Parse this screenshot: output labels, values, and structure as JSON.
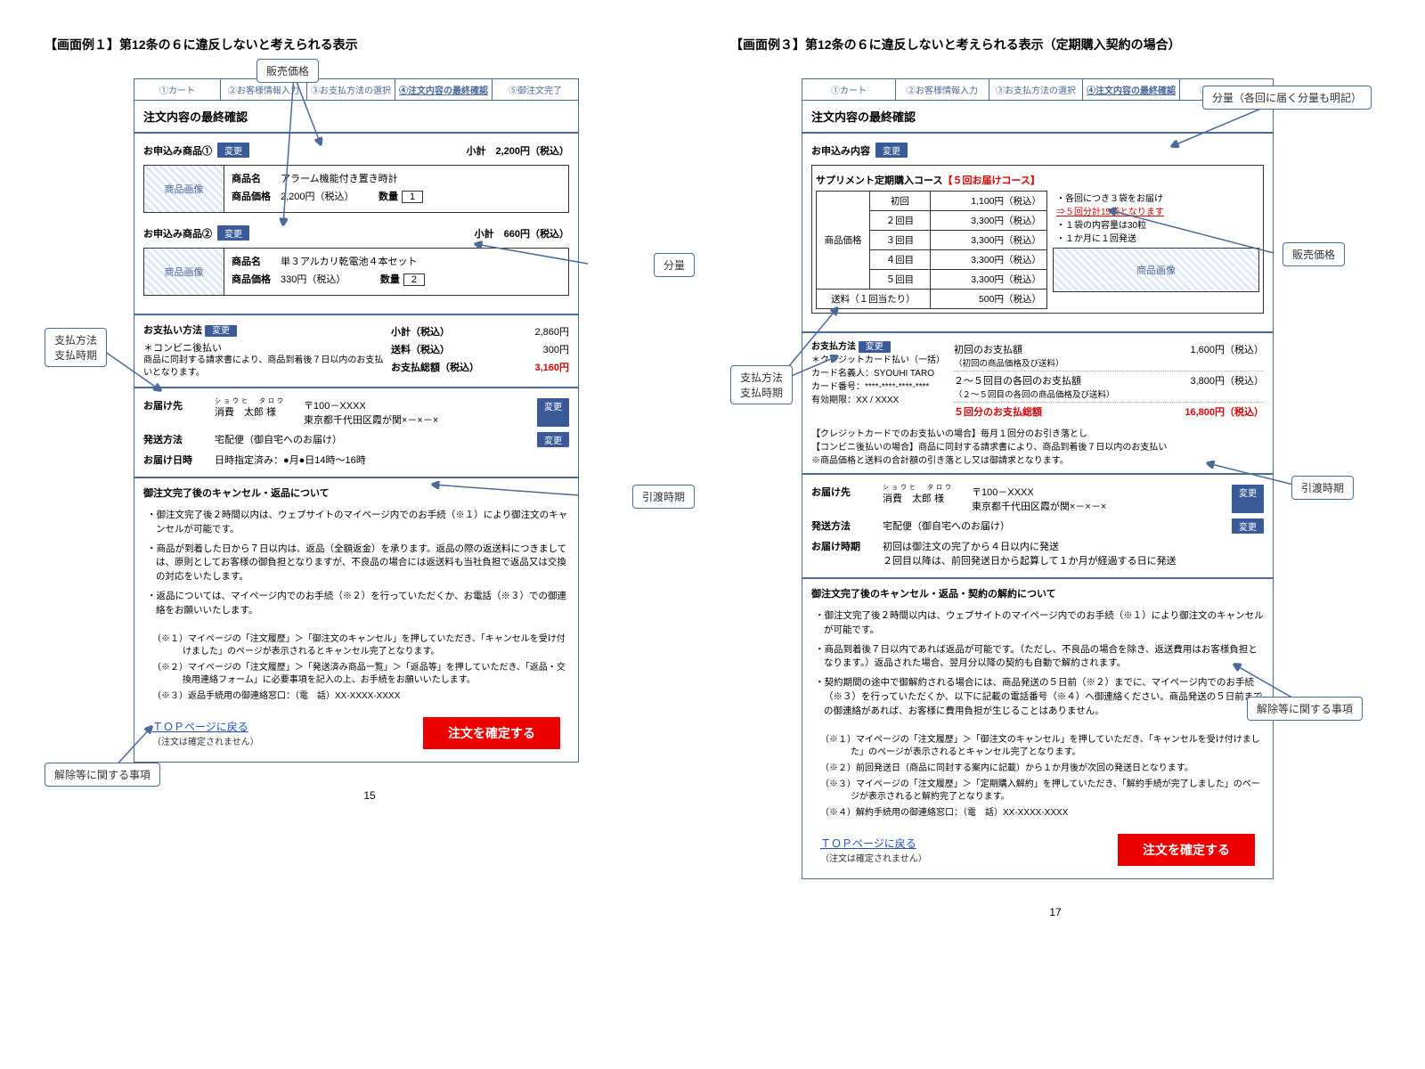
{
  "example1": {
    "title": "【画面例１】第12条の６に違反しないと考えられる表示",
    "steps": [
      "①カート",
      "②お客様情報入力",
      "③お支払方法の選択",
      "④注文内容の最終確認",
      "⑤御注文完了"
    ],
    "confirmTitle": "注文内容の最終確認",
    "item1": {
      "head": "お申込み商品①",
      "change": "変更",
      "subtotalLabel": "小計",
      "subtotal": "2,200円（税込）",
      "img": "商品画像",
      "nameLabel": "商品名",
      "name": "アラーム機能付き置き時計",
      "priceLabel": "商品価格",
      "price": "2,200円（税込）",
      "qtyLabel": "数量",
      "qty": "1"
    },
    "item2": {
      "head": "お申込み商品②",
      "change": "変更",
      "subtotalLabel": "小計",
      "subtotal": "660円（税込）",
      "img": "商品画像",
      "nameLabel": "商品名",
      "name": "単３アルカリ乾電池４本セット",
      "priceLabel": "商品価格",
      "price": "330円（税込）",
      "qtyLabel": "数量",
      "qty": "2"
    },
    "payment": {
      "head": "お支払い方法",
      "change": "変更",
      "method": "＊コンビニ後払い",
      "methodNote": "商品に同封する請求書により、商品到着後７日以内のお支払いとなります。",
      "subtotalLabel": "小計（税込）",
      "subtotal": "2,860円",
      "shipLabel": "送料（税込）",
      "ship": "300円",
      "totalLabel": "お支払総額（税込）",
      "total": "3,160円"
    },
    "delivery": {
      "destLabel": "お届け先",
      "name": "消費　太郎 様",
      "ruby": "ショウヒ　タロウ",
      "addr": "〒100－XXXX\n東京都千代田区霞が関×－×－×",
      "change": "変更",
      "methodLabel": "発送方法",
      "method": "宅配便（御自宅へのお届け）",
      "timeLabel": "お届け日時",
      "time": "日時指定済み：●月●日14時～16時"
    },
    "cancelTitle": "御注文完了後のキャンセル・返品について",
    "cancelItems": [
      "・御注文完了後２時間以内は、ウェブサイトのマイページ内でのお手続（※１）により御注文のキャンセルが可能です。",
      "・商品が到着した日から７日以内は、返品（全額返金）を承ります。返品の際の返送料につきましては、原則としてお客様の御負担となりますが、不良品の場合には返送料も当社負担で返品又は交換の対応をいたします。",
      "・返品については、マイページ内でのお手続（※２）を行っていただくか、お電話（※３）での御連絡をお願いいたします。"
    ],
    "footnotes": [
      "（※１）マイページの「注文履歴」＞「御注文のキャンセル」を押していただき、「キャンセルを受け付けました」のページが表示されるとキャンセル完了となります。",
      "（※２）マイページの「注文履歴」＞「発送済み商品一覧」＞「返品等」を押していただき、「返品・交換用連絡フォーム」に必要事項を記入の上、お手続をお願いいたします。",
      "（※３）返品手続用の御連絡窓口：（電　話）XX-XXXX-XXXX"
    ],
    "topLink": "ＴＯＰページに戻る",
    "topNote": "（注文は確定されません）",
    "confirmBtn": "注文を確定する",
    "pagenum": "15",
    "callouts": {
      "price": "販売価格",
      "qty": "分量",
      "payMethod": "支払方法\n支払時期",
      "delivTime": "引渡時期",
      "cancel": "解除等に関する事項"
    }
  },
  "example3": {
    "title": "【画面例３】第12条の６に違反しないと考えられる表示（定期購入契約の場合）",
    "steps": [
      "①カート",
      "②お客様情報入力",
      "③お支払方法の選択",
      "④注文内容の最終確認",
      "⑤御注文完了"
    ],
    "confirmTitle": "注文内容の最終確認",
    "order": {
      "head": "お申込み内容",
      "change": "変更",
      "course": "サプリメント定期購入コース",
      "courseRed": "【５回お届けコース】",
      "priceLabel": "商品価格",
      "rows": [
        [
          "初回",
          "1,100円（税込）"
        ],
        [
          "２回目",
          "3,300円（税込）"
        ],
        [
          "３回目",
          "3,300円（税込）"
        ],
        [
          "４回目",
          "3,300円（税込）"
        ],
        [
          "５回目",
          "3,300円（税込）"
        ]
      ],
      "shipRow": [
        "送料（１回当たり）",
        "500円（税込）"
      ],
      "sideNotes": [
        "・各回につき３袋をお届け",
        "⇒５回分計15袋となります",
        "・１袋の内容量は30粒",
        "・１か月に１回発送"
      ],
      "img": "商品画像"
    },
    "payment": {
      "head": "お支払方法",
      "change": "変更",
      "left": [
        "＊クレジットカード払い（一括）",
        "カード名義人：SYOUHI TARO",
        "カード番号：****-****-****-****",
        "有効期限：XX / XXXX"
      ],
      "rows": [
        {
          "label": "初回のお支払額",
          "sub": "（初回の商品価格及び送料）",
          "val": "1,600円（税込）"
        },
        {
          "label": "２～５回目の各回のお支払額",
          "sub": "（２～５回目の各回の商品価格及び送料）",
          "val": "3,800円（税込）"
        },
        {
          "label": "５回分のお支払総額",
          "val": "16,800円（税込）",
          "red": true
        }
      ]
    },
    "shipNote": [
      "【クレジットカードでのお支払いの場合】毎月１回分のお引き落とし",
      "【コンビニ後払いの場合】商品に同封する請求書により、商品到着後７日以内のお支払い",
      "※商品価格と送料の合計額の引き落とし又は御請求となります。"
    ],
    "delivery": {
      "destLabel": "お届け先",
      "name": "消費　太郎 様",
      "ruby": "ショウヒ　タロウ",
      "addr": "〒100－XXXX\n東京都千代田区霞が関×－×－×",
      "change": "変更",
      "methodLabel": "発送方法",
      "method": "宅配便（御自宅へのお届け）",
      "timeLabel": "お届け時期",
      "time": "初回は御注文の完了から４日以内に発送\n２回目以降は、前回発送日から起算して１か月が経過する日に発送"
    },
    "cancelTitle": "御注文完了後のキャンセル・返品・契約の解約について",
    "cancelItems": [
      "・御注文完了後２時間以内は、ウェブサイトのマイページ内でのお手続（※１）により御注文のキャンセルが可能です。",
      "・商品到着後７日以内であれば返品が可能です。（ただし、不良品の場合を除き、返送費用はお客様負担となります。）返品された場合、翌月分以降の契約も自動で解約されます。",
      "・契約期間の途中で御解約される場合には、商品発送の５日前（※２）までに、マイページ内でのお手続（※３）を行っていただくか、以下に記載の電話番号（※４）へ御連絡ください。商品発送の５日前までの御連絡があれば、お客様に費用負担が生じることはありません。"
    ],
    "footnotes": [
      "（※１）マイページの「注文履歴」＞「御注文のキャンセル」を押していただき、「キャンセルを受け付けました」のページが表示されるとキャンセル完了となります。",
      "（※２）前回発送日（商品に同封する案内に記載）から１か月後が次回の発送日となります。",
      "（※３）マイページの「注文履歴」＞「定期購入解約」を押していただき、「解約手続が完了しました」のページが表示されると解約完了となります。",
      "（※４）解約手続用の御連絡窓口：（電　話）XX-XXXX-XXXX"
    ],
    "topLink": "ＴＯＰページに戻る",
    "topNote": "（注文は確定されません）",
    "confirmBtn": "注文を確定する",
    "pagenum": "17",
    "callouts": {
      "qty": "分量（各回に届く分量も明記）",
      "price": "販売価格",
      "payMethod": "支払方法\n支払時期",
      "delivTime": "引渡時期",
      "cancel": "解除等に関する事項"
    }
  }
}
